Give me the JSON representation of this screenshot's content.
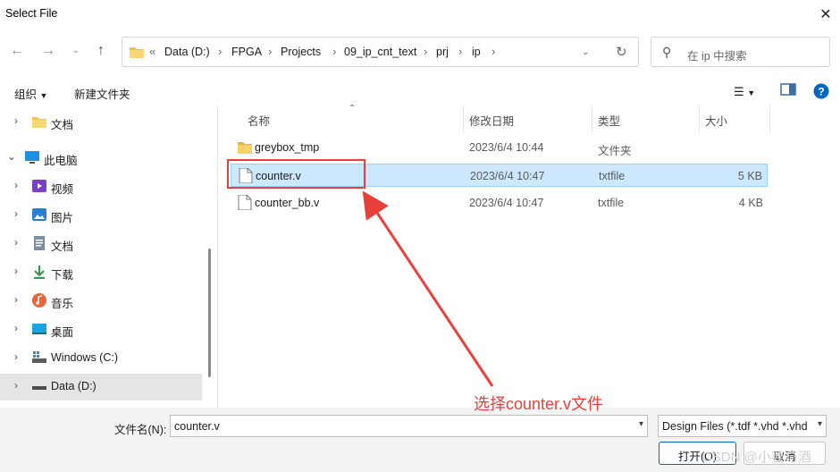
{
  "window": {
    "title": "Select File"
  },
  "nav": {
    "address": {
      "root": "«",
      "segments": [
        "Data (D:)",
        "FPGA",
        "Projects",
        "09_ip_cnt_text",
        "prj",
        "ip"
      ]
    },
    "search_placeholder": "在 ip 中搜索"
  },
  "toolbar": {
    "organize": "组织",
    "new_folder": "新建文件夹"
  },
  "sidebar": {
    "items": [
      {
        "label": "文档",
        "icon": "folder-icon"
      },
      {
        "label": "此电脑",
        "icon": "pc-icon"
      },
      {
        "label": "视频",
        "icon": "video-icon"
      },
      {
        "label": "图片",
        "icon": "picture-icon"
      },
      {
        "label": "文档",
        "icon": "document-icon"
      },
      {
        "label": "下载",
        "icon": "download-icon"
      },
      {
        "label": "音乐",
        "icon": "music-icon"
      },
      {
        "label": "桌面",
        "icon": "desktop-icon"
      },
      {
        "label": "Windows (C:)",
        "icon": "drive-icon"
      },
      {
        "label": "Data (D:)",
        "icon": "drive-icon"
      }
    ]
  },
  "columns": {
    "name": "名称",
    "date": "修改日期",
    "type": "类型",
    "size": "大小"
  },
  "files": [
    {
      "name": "greybox_tmp",
      "date": "2023/6/4 10:44",
      "type": "文件夹",
      "size": "",
      "icon": "folder-icon"
    },
    {
      "name": "counter.v",
      "date": "2023/6/4 10:47",
      "type": "txtfile",
      "size": "5 KB",
      "icon": "file-icon",
      "selected": true
    },
    {
      "name": "counter_bb.v",
      "date": "2023/6/4 10:47",
      "type": "txtfile",
      "size": "4 KB",
      "icon": "file-icon"
    }
  ],
  "footer": {
    "filename_label": "文件名(N):",
    "filename_value": "counter.v",
    "filter_value": "Design Files (*.tdf *.vhd *.vhd",
    "open_label": "打开(O)",
    "cancel_label": "取消"
  },
  "annotation": {
    "text": "选择counter.v文件",
    "color": "#e8413c"
  },
  "watermark": "CSDN @小姜与酒",
  "colors": {
    "selection": "#cce8ff",
    "accent": "#0067c0",
    "folder": "#f4c542"
  }
}
